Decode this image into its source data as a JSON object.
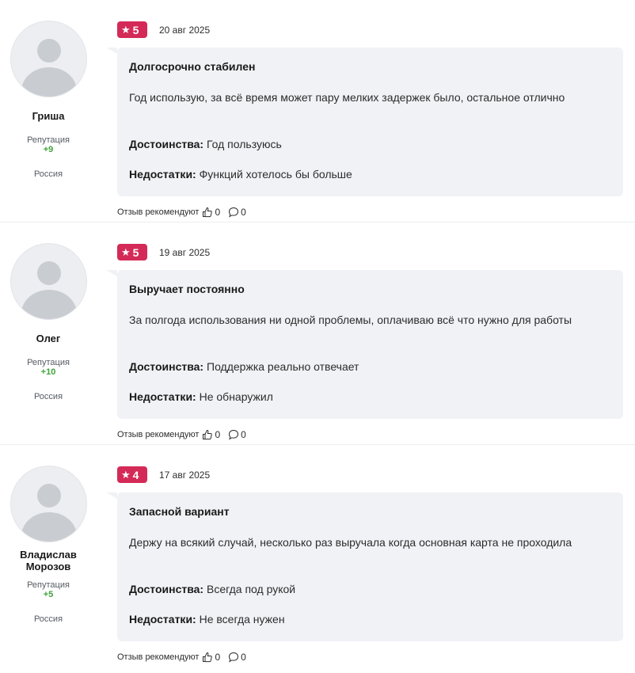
{
  "reviews": [
    {
      "author": "Гриша",
      "reputation_label": "Репутация",
      "reputation_value": "+9",
      "country": "Россия",
      "rating": "5",
      "date": "20 авг 2025",
      "title": "Долгосрочно стабилен",
      "text": "Год использую, за всё время может пару мелких задержек было, остальное отлично",
      "pros_label": "Достоинства:",
      "pros": "Год пользуюсь",
      "cons_label": "Недостатки:",
      "cons": "Функций хотелось бы больше",
      "recommend_label": "Отзыв рекомендуют",
      "likes": "0",
      "comments": "0"
    },
    {
      "author": "Олег",
      "reputation_label": "Репутация",
      "reputation_value": "+10",
      "country": "Россия",
      "rating": "5",
      "date": "19 авг 2025",
      "title": "Выручает постоянно",
      "text": "За полгода использования ни одной проблемы, оплачиваю всё что нужно для работы",
      "pros_label": "Достоинства:",
      "pros": "Поддержка реально отвечает",
      "cons_label": "Недостатки:",
      "cons": "Не обнаружил",
      "recommend_label": "Отзыв рекомендуют",
      "likes": "0",
      "comments": "0"
    },
    {
      "author": "Владислав Морозов",
      "reputation_label": "Репутация",
      "reputation_value": "+5",
      "country": "Россия",
      "rating": "4",
      "date": "17 авг 2025",
      "title": "Запасной вариант",
      "text": "Держу на всякий случай, несколько раз выручала когда основная карта не проходила",
      "pros_label": "Достоинства:",
      "pros": "Всегда под рукой",
      "cons_label": "Недостатки:",
      "cons": "Не всегда нужен",
      "recommend_label": "Отзыв рекомендуют",
      "likes": "0",
      "comments": "0"
    }
  ],
  "icons": {
    "rating": "star-icon",
    "like": "thumbs-up-icon",
    "comment": "comment-bubble-icon",
    "avatar": "user-avatar-placeholder"
  },
  "colors": {
    "rating_badge": "#d42a58",
    "reputation_positive": "#3fa33a",
    "bubble_bg": "#f1f2f6",
    "avatar_bg": "#eceef1"
  }
}
